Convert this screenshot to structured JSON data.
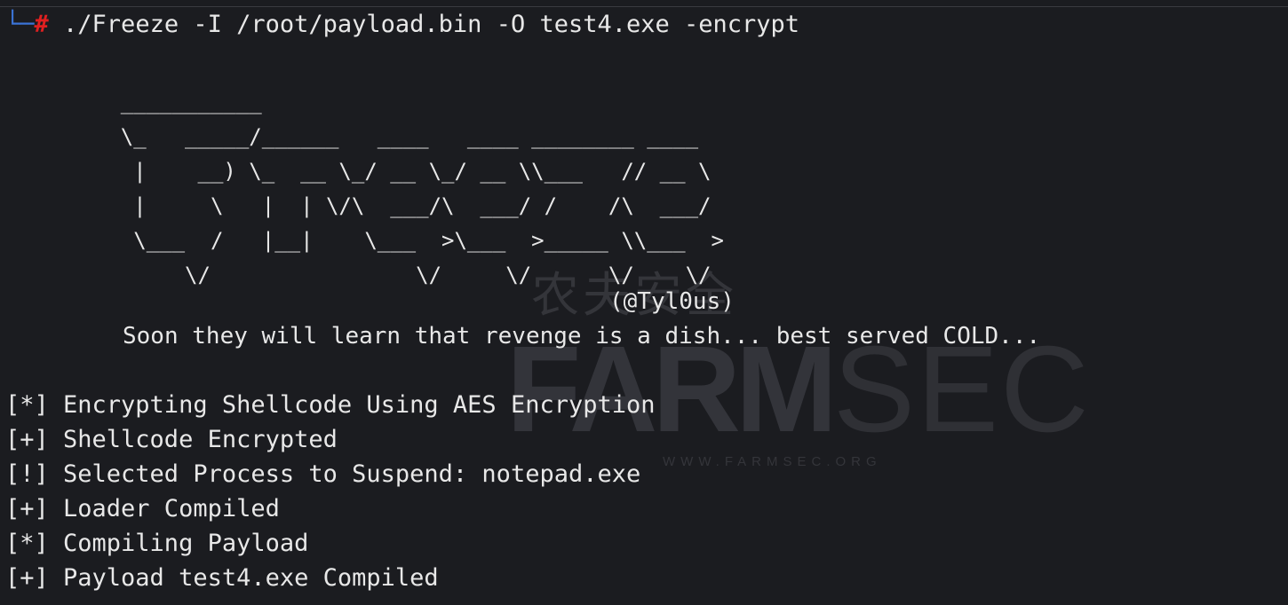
{
  "terminal": {
    "prompt_corner": "└─",
    "prompt_symbol": "#",
    "command": " ./Freeze -I /root/payload.bin -O test4.exe -encrypt",
    "banner_art": "    ___________\n    \\_   _____/______   ____   ____ ________ ____\n     |    __) \\_  __ \\_/ __ \\_/ __ \\\\___   // __ \\\n     |     \\   |  | \\/\\  ___/\\  ___/ /    /\\  ___/\n     \\___  /   |__|    \\___  >\\___  >_____ \\\\___  >\n         \\/                \\/     \\/      \\/    \\/",
    "credit": "(@Tyl0us)",
    "tagline": "Soon they will learn that revenge is a dish... best served COLD...",
    "status_lines": [
      "[*] Encrypting Shellcode Using AES Encryption",
      "[+] Shellcode Encrypted",
      "[!] Selected Process to Suspend: notepad.exe",
      "[+] Loader Compiled",
      "[*] Compiling Payload",
      "[+] Payload test4.exe Compiled"
    ]
  },
  "watermark": {
    "chinese": "农夫安全",
    "brand_left": "FARM",
    "brand_right": "SEC",
    "url": "WWW.FARMSEC.ORG"
  },
  "colors": {
    "background": "#1b1c20",
    "text": "#e8e8e8",
    "prompt_corner": "#3b73d6",
    "prompt_hash": "#e02020"
  }
}
